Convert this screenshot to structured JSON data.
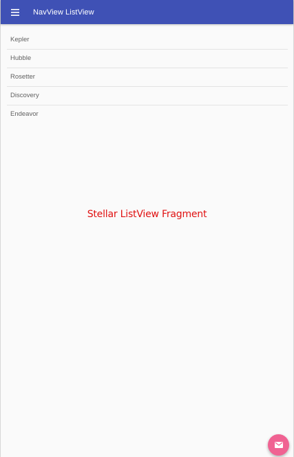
{
  "colors": {
    "toolbar": "#3f51b5",
    "background": "#fafafa",
    "fragment_label": "#e01010",
    "fab": "#f06292"
  },
  "toolbar": {
    "menu_icon": "menu-icon",
    "title": "NavView ListView"
  },
  "list": {
    "items": [
      {
        "label": "Kepler"
      },
      {
        "label": "Hubble"
      },
      {
        "label": "Rosetter"
      },
      {
        "label": "Discovery"
      },
      {
        "label": "Endeavor"
      }
    ]
  },
  "main": {
    "fragment_label": "Stellar ListView Fragment"
  },
  "fab": {
    "icon": "mail-icon"
  }
}
